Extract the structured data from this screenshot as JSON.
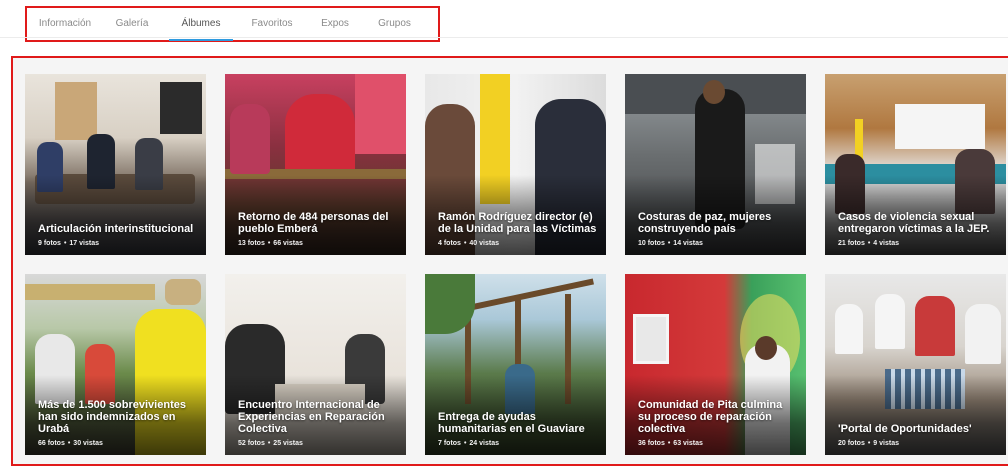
{
  "tabs": [
    {
      "label": "Información",
      "active": false
    },
    {
      "label": "Galería",
      "active": false
    },
    {
      "label": "Álbumes",
      "active": true
    },
    {
      "label": "Favoritos",
      "active": false
    },
    {
      "label": "Expos",
      "active": false
    },
    {
      "label": "Grupos",
      "active": false
    }
  ],
  "albums": [
    {
      "title": "Articulación interinstitucional",
      "photos": "9 fotos",
      "views": "17 vistas"
    },
    {
      "title": "Retorno de 484 personas del pueblo Emberá",
      "photos": "13 fotos",
      "views": "66 vistas"
    },
    {
      "title": "Ramón Rodríguez director (e) de la Unidad para las Víctimas",
      "photos": "4 fotos",
      "views": "40 vistas"
    },
    {
      "title": "Costuras de paz, mujeres construyendo país",
      "photos": "10 fotos",
      "views": "14 vistas"
    },
    {
      "title": "Casos de violencia sexual entregaron víctimas a la JEP.",
      "photos": "21 fotos",
      "views": "4 vistas"
    },
    {
      "title": "Más de 1.500 sobrevivientes han sido indemnizados en Urabá",
      "photos": "66 fotos",
      "views": "30 vistas"
    },
    {
      "title": "Encuentro Internacional de Experiencias en Reparación Colectiva",
      "photos": "52 fotos",
      "views": "25 vistas"
    },
    {
      "title": "Entrega de ayudas humanitarias en el Guaviare",
      "photos": "7 fotos",
      "views": "24 vistas"
    },
    {
      "title": "Comunidad de Pita culmina su proceso de reparación colectiva",
      "photos": "36 fotos",
      "views": "63 vistas"
    },
    {
      "title": "'Portal de Oportunidades'",
      "photos": "20 fotos",
      "views": "9 vistas"
    }
  ],
  "colors": {
    "highlight_border": "#e01a1a",
    "active_tab_underline": "#2f9be0"
  }
}
